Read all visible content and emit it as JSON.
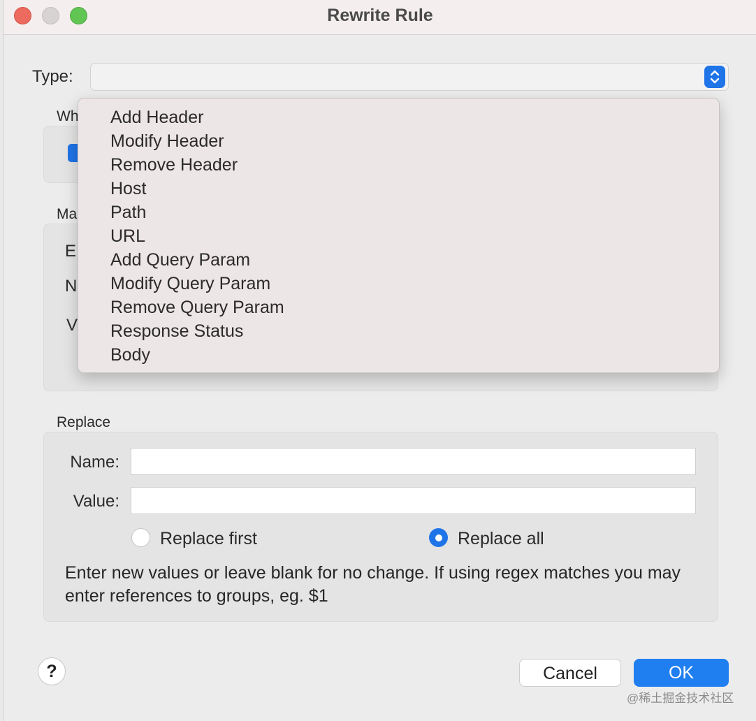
{
  "window": {
    "title": "Rewrite Rule"
  },
  "type": {
    "label": "Type:",
    "value": ""
  },
  "type_menu": {
    "items": [
      "Add Header",
      "Modify Header",
      "Remove Header",
      "Host",
      "Path",
      "URL",
      "Add Query Param",
      "Modify Query Param",
      "Remove Query Param",
      "Response Status",
      "Body"
    ]
  },
  "where": {
    "label_partial": "Wh"
  },
  "match": {
    "label_partial": "Ma",
    "row1_partial": "E",
    "row2_partial": "N",
    "row3_partial": "V"
  },
  "replace": {
    "label": "Replace",
    "name_label": "Name:",
    "name_value": "",
    "value_label": "Value:",
    "value_value": "",
    "radio_first": "Replace first",
    "radio_all": "Replace all",
    "selected": "Replace all",
    "hint": "Enter new values or leave blank for no change. If using regex matches you may enter references to groups, eg. $1"
  },
  "footer": {
    "help": "?",
    "cancel": "Cancel",
    "ok": "OK"
  },
  "watermark": "@稀土掘金技术社区",
  "colors": {
    "accent": "#1f74e8",
    "close": "#ed6a5e",
    "maximize": "#61c554"
  }
}
